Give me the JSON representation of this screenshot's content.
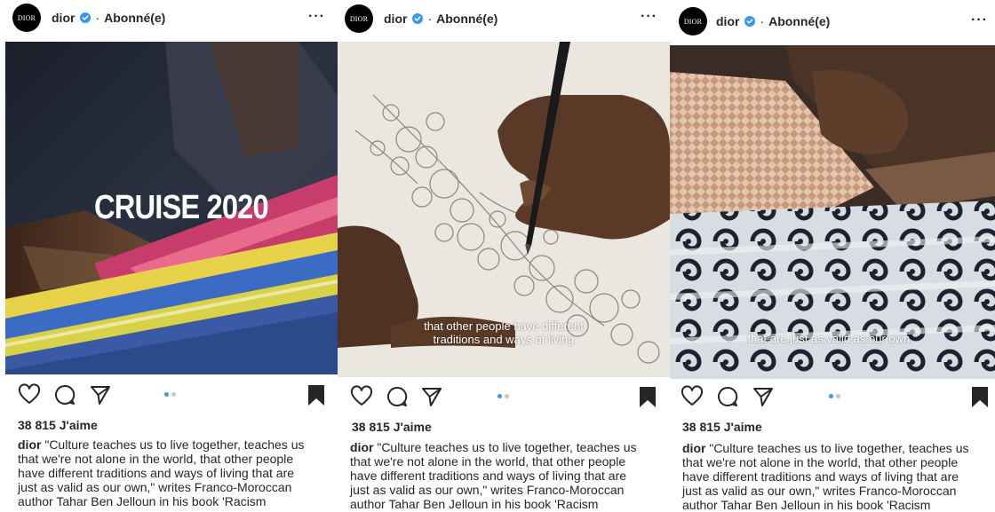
{
  "posts": [
    {
      "avatar_text": "DIOR",
      "username": "dior",
      "separator": "·",
      "follow_status": "Abonné(e)",
      "more": "···",
      "overlay_title": "CRUISE 2020",
      "overlay_caption": [],
      "likes": "38 815 J'aime",
      "caption_user": "dior",
      "caption_lines": [
        "\"Culture teaches us to live together, teaches us",
        "that we're not alone in the world, that other people",
        "have different traditions and ways of living that are",
        "just as valid as our own,\" writes Franco-Moroccan",
        "author Tahar Ben Jelloun in his book 'Racism"
      ]
    },
    {
      "avatar_text": "DIOR",
      "username": "dior",
      "separator": "·",
      "follow_status": "Abonné(e)",
      "more": "···",
      "overlay_title": "",
      "overlay_caption": [
        "that other people have different",
        "traditions and ways of living"
      ],
      "likes": "38 815 J'aime",
      "caption_user": "dior",
      "caption_lines": [
        "\"Culture teaches us to live together, teaches us",
        "that we're not alone in the world, that other people",
        "have different traditions and ways of living that are",
        "just as valid as our own,\" writes Franco-Moroccan",
        "author Tahar Ben Jelloun in his book 'Racism"
      ]
    },
    {
      "avatar_text": "DIOR",
      "username": "dior",
      "separator": "·",
      "follow_status": "Abonné(e)",
      "more": "···",
      "overlay_title": "",
      "overlay_caption": [
        "that are just as valid as our own.\""
      ],
      "likes": "38 815 J'aime",
      "caption_user": "dior",
      "caption_lines": [
        "\"Culture teaches us to live together, teaches us",
        "that we're not alone in the world, that other people",
        "have different traditions and ways of living that are",
        "just as valid as our own,\" writes Franco-Moroccan",
        "author Tahar Ben Jelloun in his book 'Racism"
      ]
    }
  ],
  "icons": {
    "verified": "verified-badge-icon",
    "like": "heart-icon",
    "comment": "comment-bubble-icon",
    "share": "paper-plane-icon",
    "save": "bookmark-icon",
    "more": "more-options-icon"
  },
  "colors": {
    "text": "#262626",
    "verified": "#3897f0",
    "carousel_active": "#3897f0",
    "carousel_inactive": "#c7c7c7"
  },
  "carousel": {
    "total": 2,
    "active": 1
  }
}
